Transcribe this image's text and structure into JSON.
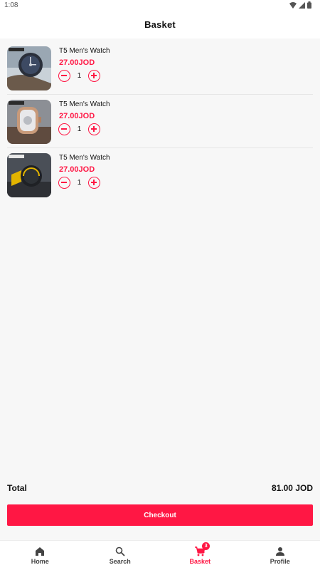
{
  "status_bar": {
    "time": "1:08",
    "icons": [
      "wifi-icon",
      "signal-icon",
      "battery-icon"
    ]
  },
  "header": {
    "title": "Basket"
  },
  "basket": {
    "items": [
      {
        "title": "T5 Men's Watch",
        "price": "27.00JOD",
        "quantity": "1",
        "image": "watch-dark-blue"
      },
      {
        "title": "T5 Men's Watch",
        "price": "27.00JOD",
        "quantity": "1",
        "image": "watch-rose-gold"
      },
      {
        "title": "T5 Men's Watch",
        "price": "27.00JOD",
        "quantity": "1",
        "image": "watch-yellow-black"
      }
    ]
  },
  "summary": {
    "total_label": "Total",
    "total_value": "81.00 JOD"
  },
  "checkout": {
    "label": "Checkout"
  },
  "bottom_nav": {
    "items": [
      {
        "label": "Home",
        "icon": "home-icon",
        "active": false
      },
      {
        "label": "Search",
        "icon": "search-icon",
        "active": false
      },
      {
        "label": "Basket",
        "icon": "cart-icon",
        "active": true,
        "badge": "3"
      },
      {
        "label": "Profile",
        "icon": "person-icon",
        "active": false
      }
    ]
  },
  "colors": {
    "accent": "#ff1744",
    "background": "#f7f7f7",
    "surface": "#ffffff"
  }
}
